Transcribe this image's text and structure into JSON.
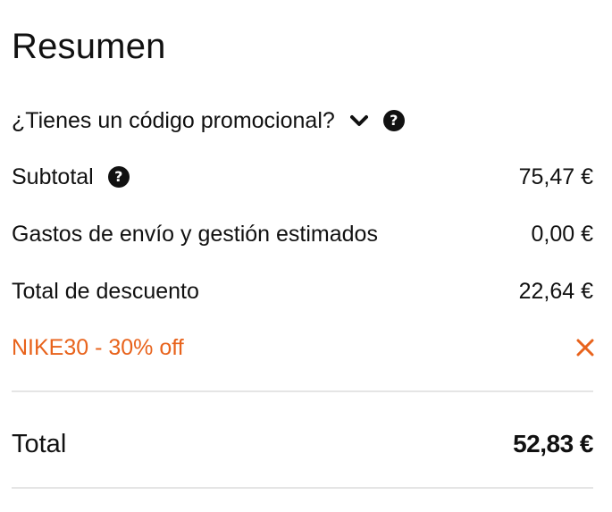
{
  "summary": {
    "title": "Resumen",
    "promo": {
      "question": "¿Tienes un código promocional?",
      "chevron_icon": "chevron-down-icon",
      "help_icon": "question-circle-icon",
      "help_glyph": "?"
    },
    "lines": [
      {
        "label": "Subtotal",
        "amount": "75,47 €",
        "has_help": true
      },
      {
        "label": "Gastos de envío y gestión estimados",
        "amount": "0,00 €",
        "has_help": false
      },
      {
        "label": "Total de descuento",
        "amount": "22,64 €",
        "has_help": false
      }
    ],
    "applied_promo": {
      "label": "NIKE30 - 30% off",
      "remove_icon": "close-icon",
      "color": "#e8631c"
    },
    "total": {
      "label": "Total",
      "amount": "52,83 €"
    },
    "colors": {
      "text": "#111111",
      "accent": "#e8631c",
      "divider": "#e5e5e5"
    }
  }
}
